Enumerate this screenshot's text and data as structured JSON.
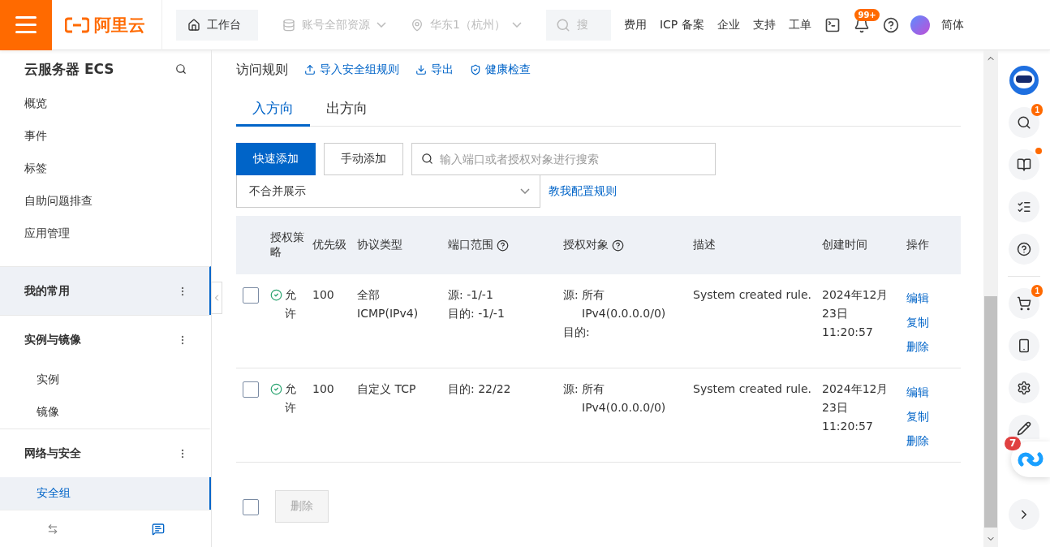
{
  "topbar": {
    "logo_text": "阿里云",
    "workbench": "工作台",
    "resource": "账号全部资源",
    "region": "华东1（杭州）",
    "search_placeholder": "搜",
    "nav_links": [
      "费用",
      "ICP 备案",
      "企业",
      "支持",
      "工单"
    ],
    "notification_count": "99+",
    "language": "简体"
  },
  "sidebar": {
    "title": "云服务器 ECS",
    "items": [
      "概览",
      "事件",
      "标签",
      "自助问题排查",
      "应用管理"
    ],
    "groups": [
      {
        "label": "我的常用",
        "selected": true
      },
      {
        "label": "实例与镜像",
        "selected": false,
        "children": [
          {
            "label": "实例",
            "selected": false
          },
          {
            "label": "镜像",
            "selected": false
          }
        ]
      },
      {
        "label": "网络与安全",
        "selected": false,
        "children": [
          {
            "label": "安全组",
            "selected": true
          }
        ]
      }
    ]
  },
  "main": {
    "title": "访问规则",
    "actions": [
      {
        "kind": "upload",
        "label": "导入安全组规则"
      },
      {
        "kind": "download",
        "label": "导出"
      },
      {
        "kind": "shield",
        "label": "健康检查"
      }
    ],
    "tabs": [
      {
        "label": "入方向",
        "selected": true
      },
      {
        "label": "出方向",
        "selected": false
      }
    ],
    "buttons": [
      {
        "label": "快速添加",
        "kind": "primary"
      },
      {
        "label": "手动添加",
        "kind": "default"
      }
    ],
    "search_placeholder": "输入端口或者授权对象进行搜索",
    "view_select": "不合并展示",
    "help_link": "教我配置规则",
    "table": {
      "columns": [
        {
          "label": "授权策略",
          "help": false
        },
        {
          "label": "优先级",
          "help": false
        },
        {
          "label": "协议类型",
          "help": false
        },
        {
          "label": "端口范围",
          "help": true
        },
        {
          "label": "授权对象",
          "help": true
        },
        {
          "label": "描述",
          "help": false
        },
        {
          "label": "创建时间",
          "help": false
        },
        {
          "label": "操作",
          "help": false
        }
      ],
      "rows": [
        {
          "checked": false,
          "policy": "允许",
          "priority": "100",
          "protocol": "全部 ICMP(IPv4)",
          "ports": [
            "源: -1/-1",
            "目的: -1/-1"
          ],
          "objects": [
            {
              "prefix": "源:",
              "values": [
                "所有",
                "IPv4(0.0.0.0/0)"
              ]
            },
            {
              "prefix": "目的:"
            }
          ],
          "description": "System created rule.",
          "created": [
            "2024年12月",
            "23日",
            "11:20:57"
          ],
          "operations": [
            "编辑",
            "复制",
            "删除"
          ]
        },
        {
          "checked": false,
          "policy": "允许",
          "priority": "100",
          "protocol": "自定义 TCP",
          "ports": [
            "目的: 22/22"
          ],
          "objects": [
            {
              "prefix": "源:",
              "values": [
                "所有",
                "IPv4(0.0.0.0/0)"
              ]
            }
          ],
          "description": "System created rule.",
          "created": [
            "2024年12月",
            "23日",
            "11:20:57"
          ],
          "operations": [
            "编辑",
            "复制",
            "删除"
          ]
        }
      ]
    },
    "footer": {
      "select_all_checked": false,
      "delete_button": {
        "label": "删除",
        "disabled": true
      }
    }
  },
  "right_rail": {
    "search_badge": "1",
    "cart_badge": "1",
    "float_badge": "7"
  }
}
